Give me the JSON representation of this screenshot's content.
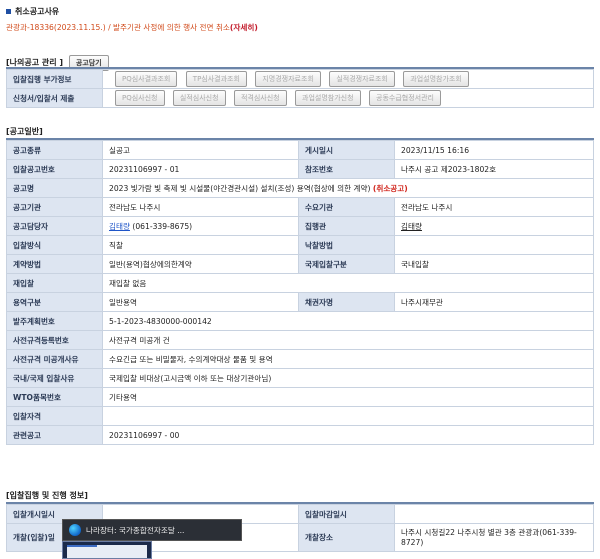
{
  "cancel": {
    "title": "취소공고사유",
    "message": "관광과-18336(2023.11.15.) / 발주기관 사정에 의한 행사 전면 취소",
    "detail_link": "(자세히)"
  },
  "my_notice": {
    "title": "[나의공고 관리 ]",
    "button": "공고담기",
    "rows": [
      {
        "label": "입찰집행 부가정보",
        "buttons": [
          "PQ심사결과조회",
          "TP심사결과조회",
          "지명경쟁자료조회",
          "실적경쟁자료조회",
          "과업설명참가조회"
        ]
      },
      {
        "label": "신청서/입찰서 제출",
        "buttons": [
          "PQ심사신청",
          "실적심사신청",
          "적격심사신청",
          "과업설명참가신청",
          "공동수급협정서관리"
        ]
      }
    ]
  },
  "general": {
    "title": "[공고일반]",
    "notice_type_label": "공고종류",
    "notice_type": "실공고",
    "post_date_label": "게시일시",
    "post_date": "2023/11/15 16:16",
    "notice_no_label": "입찰공고번호",
    "notice_no": "20231106997 - 01",
    "ref_no_label": "참조번호",
    "ref_no": "나주시 공고 제2023-1802호",
    "name_label": "공고명",
    "name": "2023 빛가람 빛 축제 빛 시설물(야간경관시설) 설치(조성) 용역(협상에 의한 계약)",
    "name_tag": "(취소공고)",
    "agency_label": "공고기관",
    "agency": "전라남도 나주시",
    "demand_label": "수요기관",
    "demand": "전라남도 나주시",
    "manager_label": "공고담당자",
    "manager": "김태량",
    "manager_phone": "(061-339-8675)",
    "exec_label": "집행관",
    "exec": "김태량",
    "bid_method_label": "입찰방식",
    "bid_method": "직찰",
    "award_method_label": "낙찰방법",
    "award_method": "",
    "contract_method_label": "계약방법",
    "contract_method": "일반(용역)협상에의한계약",
    "intl_label": "국제입찰구분",
    "intl": "국내입찰",
    "rebid_label": "재입찰",
    "rebid": "재입찰 없음",
    "service_type_label": "용역구분",
    "service_type": "일반용역",
    "bond_label": "채권자명",
    "bond": "나주시재무관",
    "plan_no_label": "발주계획번호",
    "plan_no": "5-1-2023-4830000-000142",
    "prespec_no_label": "사전규격등록번호",
    "prespec_no": "사전규격 미공개 건",
    "prespec_reason_label": "사전규격 미공개사유",
    "prespec_reason": "수요긴급 또는 비밀물자, 수의계약대상 물품 및 용역",
    "intl_reason_label": "국내/국제 입찰사유",
    "intl_reason": "국제입찰 비대상(고시금액 이하 또는 대상기관아님)",
    "wto_label": "WTO품목번호",
    "wto": "기타용역",
    "qual_label": "입찰자격",
    "qual": "",
    "related_label": "관련공고",
    "related": "20231106997 - 00"
  },
  "progress": {
    "title": "[입찰집행 및 진행 정보]",
    "start_label": "입찰개시일시",
    "start": "",
    "close_label": "입찰마감일시",
    "close": "",
    "open_label": "개찰(입찰)일",
    "open": "",
    "place_label": "개찰장소",
    "place": "나주시 시청길22 나주시청 별관 3층 관광과(061-339-8727)"
  },
  "taskbar_popup": {
    "title": "나라장터: 국가종합전자조달 ..."
  }
}
